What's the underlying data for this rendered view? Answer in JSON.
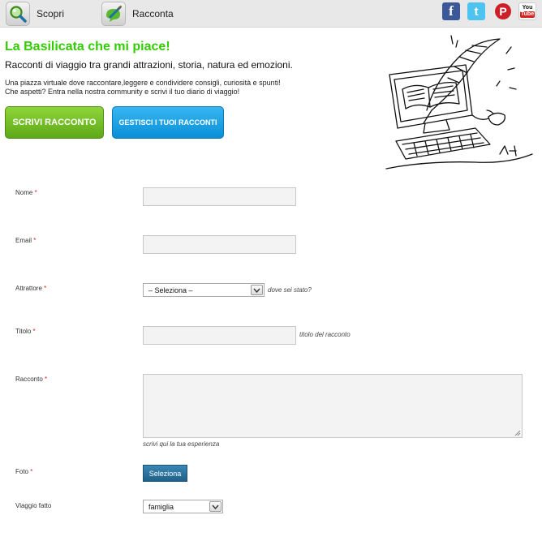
{
  "nav": {
    "scopri_label": "Scopri",
    "racconta_label": "Racconta"
  },
  "social": {
    "facebook_glyph": "f",
    "twitter_glyph": "t",
    "pinterest_glyph": "P",
    "youtube_top": "You",
    "youtube_bottom": "Tube"
  },
  "header": {
    "title": "La Basilicata che mi piace!",
    "subtitle": "Racconti di viaggio tra grandi attrazioni, storia, natura ed emozioni.",
    "desc_line1": "Una piazza virtuale dove raccontare,leggere e condividere consigli, curiosità e spunti!",
    "desc_line2": "Che aspetti? Entra nella nostra community e scrivi il tuo diario di viaggio!",
    "btn_scrivi": "SCRIVI RACCONTO",
    "btn_gestisci": "GESTISCI I TUOI RACCONTI"
  },
  "form": {
    "nome_label": "Nome",
    "email_label": "Email",
    "attrattore_label": "Attrattore",
    "attrattore_value": "– Seleziona –",
    "attrattore_hint": "dove sei stato?",
    "titolo_label": "Titolo",
    "titolo_hint": "titolo del racconto",
    "racconto_label": "Racconto",
    "racconto_hint": "scrivi qui la tua esperienza",
    "foto_label": "Foto",
    "foto_button": "Seleziona",
    "viaggio_label": "Viaggio fatto",
    "viaggio_value": "famiglia",
    "required_mark": "*"
  },
  "colors": {
    "title_green": "#33cc00",
    "btn_green": "#6cbd1f",
    "btn_blue": "#1aa0e3",
    "facebook": "#3b5998",
    "twitter": "#4fc3f0",
    "pinterest": "#cb2027",
    "youtube_red": "#d2231e",
    "select_button": "#2a7aa8",
    "required": "#e02020"
  }
}
